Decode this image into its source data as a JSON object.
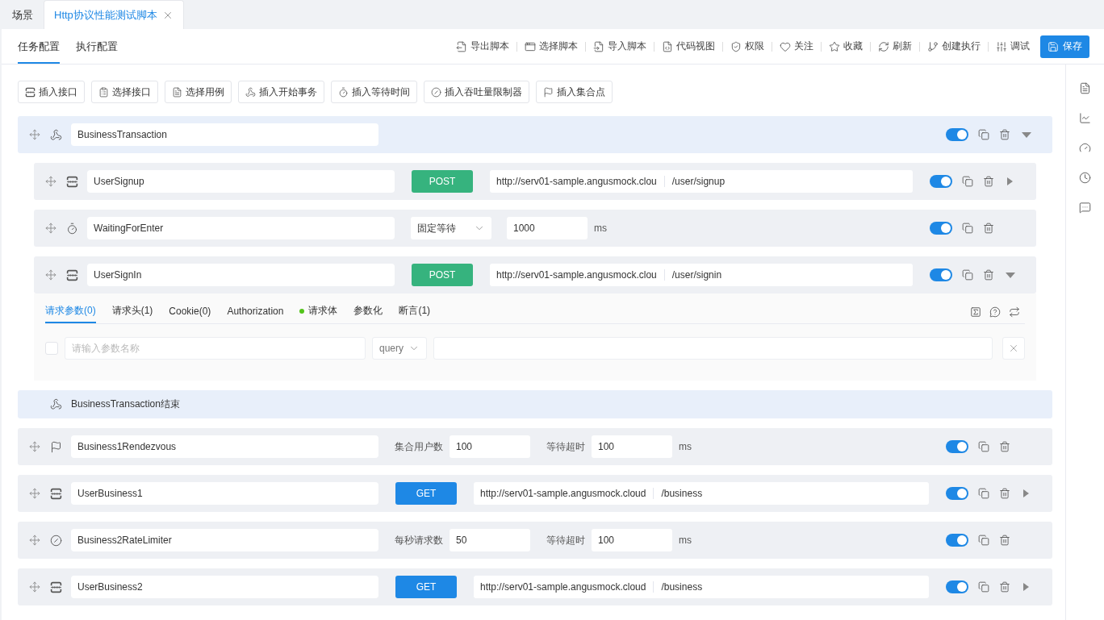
{
  "tabs": [
    {
      "label": "场景",
      "selected": false
    },
    {
      "label": "Http协议性能测试脚本",
      "selected": true
    }
  ],
  "config_tabs": [
    {
      "label": "任务配置",
      "selected": true
    },
    {
      "label": "执行配置",
      "selected": false
    }
  ],
  "toolbar": [
    "导出脚本",
    "选择脚本",
    "导入脚本",
    "代码视图",
    "权限",
    "关注",
    "收藏",
    "刷新",
    "创建执行",
    "调试"
  ],
  "save_button": "保存",
  "insert_buttons": [
    "插入接口",
    "选择接口",
    "选择用例",
    "插入开始事务",
    "插入等待时间",
    "插入吞吐量限制器",
    "插入集合点"
  ],
  "steps": [
    {
      "kind": "transaction",
      "name": "BusinessTransaction",
      "enabled": true,
      "expanded": true,
      "children": [
        {
          "kind": "http",
          "name": "UserSignup",
          "method": "POST",
          "color": "#36b37e",
          "host": "http://serv01-sample.angusmock.clou",
          "path": "/user/signup",
          "enabled": true,
          "expanded": false
        },
        {
          "kind": "wait",
          "name": "WaitingForEnter",
          "mode": "固定等待",
          "value": "1000",
          "unit": "ms",
          "enabled": true
        },
        {
          "kind": "http",
          "name": "UserSignIn",
          "method": "POST",
          "color": "#36b37e",
          "host": "http://serv01-sample.angusmock.clou",
          "path": "/user/signin",
          "enabled": true,
          "expanded": true,
          "detail": {
            "tabs": [
              {
                "label": "请求参数(0)",
                "selected": true,
                "dot": false
              },
              {
                "label": "请求头(1)",
                "selected": false,
                "dot": false
              },
              {
                "label": "Cookie(0)",
                "selected": false,
                "dot": false
              },
              {
                "label": "Authorization",
                "selected": false,
                "dot": false
              },
              {
                "label": "请求体",
                "selected": false,
                "dot": true
              },
              {
                "label": "参数化",
                "selected": false,
                "dot": false
              },
              {
                "label": "断言(1)",
                "selected": false,
                "dot": false
              }
            ],
            "param": {
              "checked": false,
              "placeholder": "请输入参数名称",
              "location": "query"
            }
          }
        }
      ]
    },
    {
      "kind": "transaction_end",
      "name": "BusinessTransaction结束"
    },
    {
      "kind": "rendezvous",
      "name": "Business1Rendezvous",
      "label1": "集合用户数",
      "value1": "100",
      "label2": "等待超时",
      "value2": "100",
      "unit": "ms",
      "enabled": true
    },
    {
      "kind": "http",
      "name": "UserBusiness1",
      "method": "GET",
      "color": "#1e88e5",
      "host": "http://serv01-sample.angusmock.cloud",
      "path": "/business",
      "enabled": true,
      "expanded": false
    },
    {
      "kind": "limiter",
      "name": "Business2RateLimiter",
      "label1": "每秒请求数",
      "value1": "50",
      "label2": "等待超时",
      "value2": "100",
      "unit": "ms",
      "enabled": true
    },
    {
      "kind": "http",
      "name": "UserBusiness2",
      "method": "GET",
      "color": "#1e88e5",
      "host": "http://serv01-sample.angusmock.cloud",
      "path": "/business",
      "enabled": true,
      "expanded": false
    }
  ]
}
